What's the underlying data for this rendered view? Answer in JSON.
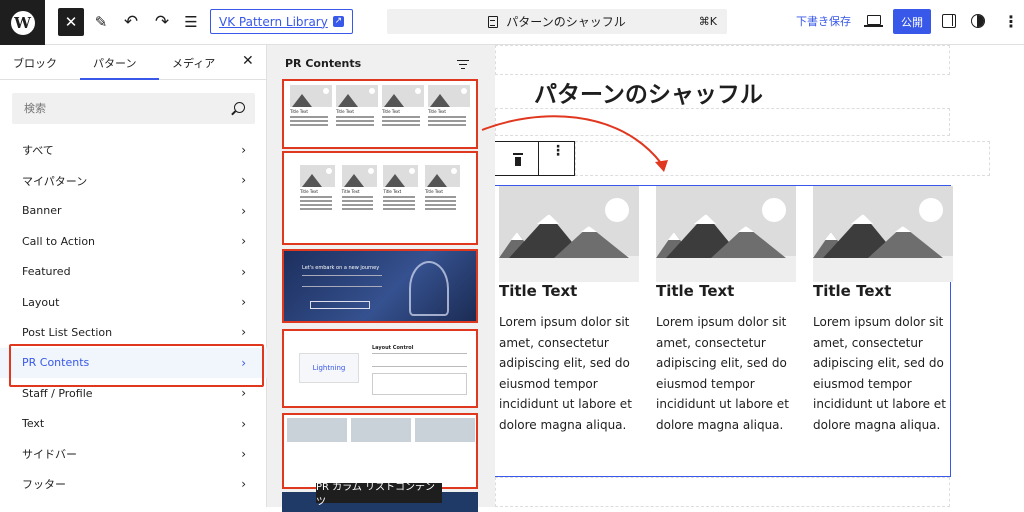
{
  "toolbar": {
    "logo": "W",
    "close_icon": "✕",
    "undo_icon": "↶",
    "redo_icon": "↷",
    "vk_pattern_label": "VK Pattern Library",
    "command_title": "パターンのシャッフル",
    "command_shortcut": "⌘K",
    "draft_label": "下書き保存",
    "publish_label": "公開",
    "more_icon": "⋮"
  },
  "inserter": {
    "tabs": [
      "ブロック",
      "パターン",
      "メディア"
    ],
    "active_tab": "パターン",
    "close_icon": "✕",
    "search_placeholder": "検索",
    "categories": [
      "すべて",
      "マイパターン",
      "Banner",
      "Call to Action",
      "Featured",
      "Layout",
      "Post List Section",
      "PR Contents",
      "Staff / Profile",
      "Text",
      "サイドバー",
      "フッター"
    ],
    "active_category": "PR Contents",
    "chevron": "›"
  },
  "previews": {
    "title": "PR Contents",
    "tooltip": "PR カラム リストコンテンツ",
    "hero_text": "Let's embark on a new journey",
    "layout_control": "Layout Control",
    "lightning_label": "Lightning"
  },
  "canvas": {
    "heading": "パターンのシャッフル",
    "more_icon": "⋮",
    "columns": [
      {
        "title": "Title Text",
        "body": "Lorem ipsum dolor sit amet, consectetur adipiscing elit, sed do eiusmod tempor incididunt ut labore et dolore magna aliqua."
      },
      {
        "title": "Title Text",
        "body": "Lorem ipsum dolor sit amet, consectetur adipiscing elit, sed do eiusmod tempor incididunt ut labore et dolore magna aliqua."
      },
      {
        "title": "Title Text",
        "body": "Lorem ipsum dolor sit amet, consectetur adipiscing elit, sed do eiusmod tempor incididunt ut labore et dolore magna aliqua."
      }
    ]
  },
  "colors": {
    "accent": "#3858e9",
    "highlight": "#e0371f"
  }
}
